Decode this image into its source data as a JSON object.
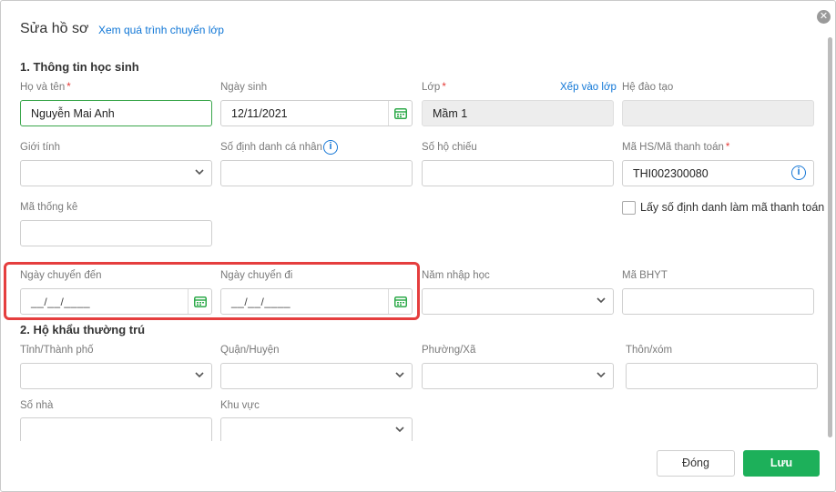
{
  "dialog": {
    "title": "Sửa hồ sơ",
    "title_link": "Xem quá trình chuyển lớp",
    "close_glyph": "✕"
  },
  "section1": {
    "title": "1. Thông tin học sinh"
  },
  "section2": {
    "title": "2. Hộ khẩu thường trú"
  },
  "fields": {
    "full_name": {
      "label": "Họ và tên",
      "required": "*",
      "value": "Nguyễn Mai Anh"
    },
    "birth_date": {
      "label": "Ngày sinh",
      "value": "12/11/2021"
    },
    "class": {
      "label": "Lớp",
      "required": "*",
      "value": "Mầm 1",
      "link": "Xếp vào lớp"
    },
    "training_system": {
      "label": "Hệ đào tạo",
      "value": ""
    },
    "gender": {
      "label": "Giới tính",
      "value": ""
    },
    "personal_id": {
      "label": "Số định danh cá nhân",
      "value": ""
    },
    "passport": {
      "label": "Số hộ chiếu",
      "value": ""
    },
    "payment_code": {
      "label": "Mã HS/Mã thanh toán",
      "required": "*",
      "value": "THI002300080"
    },
    "stat_code": {
      "label": "Mã thống kê",
      "value": ""
    },
    "use_id_as_payment": {
      "label": "Lấy số định danh làm mã thanh toán",
      "checked": false
    },
    "transfer_in_date": {
      "label": "Ngày chuyển đến",
      "placeholder": "__/__/____"
    },
    "transfer_out_date": {
      "label": "Ngày chuyển đi",
      "placeholder": "__/__/____"
    },
    "enroll_year": {
      "label": "Năm nhập học",
      "value": ""
    },
    "health_insurance": {
      "label": "Mã BHYT",
      "value": ""
    },
    "province": {
      "label": "Tỉnh/Thành phố",
      "value": ""
    },
    "district": {
      "label": "Quận/Huyện",
      "value": ""
    },
    "ward": {
      "label": "Phường/Xã",
      "value": ""
    },
    "hamlet": {
      "label": "Thôn/xóm",
      "value": ""
    },
    "house_number": {
      "label": "Số nhà",
      "value": ""
    },
    "area": {
      "label": "Khu vực",
      "value": ""
    }
  },
  "footer": {
    "close_label": "Đóng",
    "save_label": "Lưu"
  },
  "colors": {
    "accent": "#1db05a",
    "link": "#0f76d6",
    "highlight": "#e53e3e",
    "required": "#e53935"
  },
  "icons": {
    "calendar": "calendar-icon",
    "chevron": "chevron-down-icon",
    "info": "info-icon",
    "close": "close-icon"
  }
}
